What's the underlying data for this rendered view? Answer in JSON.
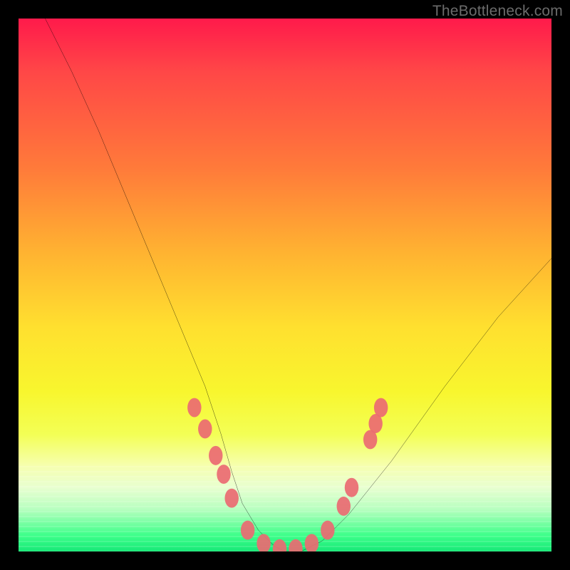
{
  "watermark": "TheBottleneck.com",
  "chart_data": {
    "type": "line",
    "title": "",
    "xlabel": "",
    "ylabel": "",
    "xlim": [
      0,
      100
    ],
    "ylim": [
      0,
      100
    ],
    "series": [
      {
        "name": "bottleneck-curve",
        "x": [
          5,
          10,
          15,
          20,
          25,
          30,
          35,
          38,
          40,
          42,
          45,
          48,
          50,
          53,
          57,
          62,
          70,
          80,
          90,
          100
        ],
        "y": [
          100,
          90,
          79,
          67,
          55,
          43,
          31,
          22,
          15,
          9,
          4,
          1,
          0,
          0,
          2,
          7,
          17,
          31,
          44,
          55
        ]
      }
    ],
    "markers": {
      "name": "hotspot-markers",
      "color": "#ea6a72",
      "points": [
        {
          "x": 33,
          "y": 27
        },
        {
          "x": 35,
          "y": 23
        },
        {
          "x": 37,
          "y": 18
        },
        {
          "x": 38.5,
          "y": 14.5
        },
        {
          "x": 40,
          "y": 10
        },
        {
          "x": 43,
          "y": 4
        },
        {
          "x": 46,
          "y": 1.5
        },
        {
          "x": 49,
          "y": 0.5
        },
        {
          "x": 52,
          "y": 0.5
        },
        {
          "x": 55,
          "y": 1.5
        },
        {
          "x": 58,
          "y": 4
        },
        {
          "x": 61,
          "y": 8.5
        },
        {
          "x": 62.5,
          "y": 12
        },
        {
          "x": 66,
          "y": 21
        },
        {
          "x": 67,
          "y": 24
        },
        {
          "x": 68,
          "y": 27
        }
      ]
    }
  }
}
